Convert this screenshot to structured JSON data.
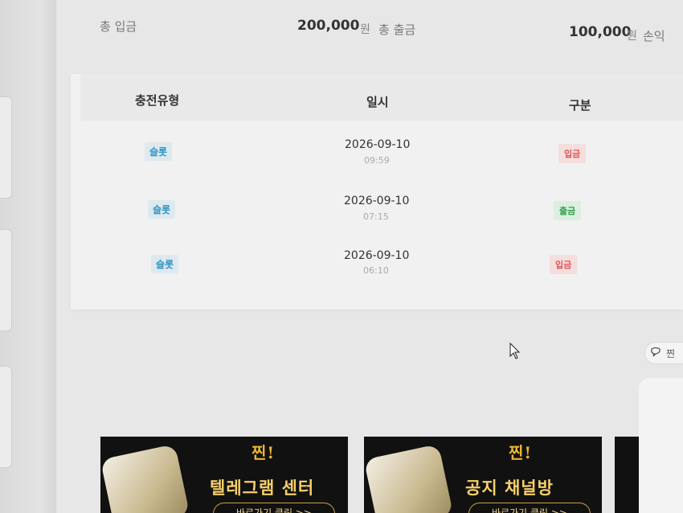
{
  "summary": {
    "total_deposit_label": "총 입금",
    "total_deposit_amount": "200,000",
    "deposit_unit": "원",
    "total_withdraw_label": "총 출금",
    "total_withdraw_amount": "100,000",
    "withdraw_unit": "원",
    "profit_label": "손익"
  },
  "table": {
    "columns": [
      "충전유형",
      "일시",
      "구분"
    ],
    "rows": [
      {
        "type": "슬롯",
        "date": "2026-09-10",
        "time": "09:59",
        "kind": "입금"
      },
      {
        "type": "슬롯",
        "date": "2026-09-10",
        "time": "07:15",
        "kind": "출금"
      },
      {
        "type": "슬롯",
        "date": "2026-09-10",
        "time": "06:10",
        "kind": "입금"
      }
    ]
  },
  "side_widget": {
    "label": "찐"
  },
  "banners": [
    {
      "logo": "찐!",
      "logo_sub": "",
      "title": "텔레그램 센터",
      "cta": "바로가기 클릭 >>"
    },
    {
      "logo": "찐!",
      "logo_sub": "",
      "title": "공지 채널방",
      "cta": "바로가기 클릭 >>"
    }
  ],
  "colors": {
    "deposit_badge_text": "#e05353",
    "withdraw_badge_text": "#2e9e4a",
    "type_badge_text": "#2a93c7",
    "banner_gold": "#f7d06a"
  }
}
